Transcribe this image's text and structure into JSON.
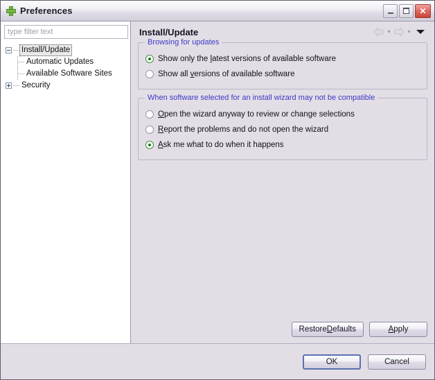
{
  "window": {
    "title": "Preferences",
    "icon": "green-plus-icon",
    "controls": {
      "minimize": "Minimize",
      "maximize": "Maximize",
      "close": "Close",
      "close_glyph": "✕"
    }
  },
  "sidebar": {
    "filter": {
      "value": "",
      "placeholder": "type filter text"
    },
    "tree": [
      {
        "label": "Install/Update",
        "expander": "minus",
        "level": 0,
        "selected": true
      },
      {
        "label": "Automatic Updates",
        "expander": "none",
        "level": 1,
        "selected": false
      },
      {
        "label": "Available Software Sites",
        "expander": "none",
        "level": 1,
        "selected": false
      },
      {
        "label": "Security",
        "expander": "plus",
        "level": 0,
        "selected": false
      }
    ]
  },
  "page": {
    "title": "Install/Update",
    "nav": {
      "back": "back-arrow",
      "forward": "forward-arrow",
      "menu": "dropdown-triangle"
    },
    "groups": [
      {
        "title": "Browsing for updates",
        "options": [
          {
            "pre": "Show only the ",
            "mnemonic": "l",
            "post": "atest versions of available software",
            "selected": true
          },
          {
            "pre": "Show all ",
            "mnemonic": "v",
            "post": "ersions of available software",
            "selected": false
          }
        ]
      },
      {
        "title": "When software selected for an install wizard may not be compatible",
        "options": [
          {
            "pre": "",
            "mnemonic": "O",
            "post": "pen the wizard anyway to review or change selections",
            "selected": false
          },
          {
            "pre": "",
            "mnemonic": "R",
            "post": "eport the problems and do not open the wizard",
            "selected": false
          },
          {
            "pre": "",
            "mnemonic": "A",
            "post": "sk me what to do when it happens",
            "selected": true
          }
        ]
      }
    ],
    "actions": {
      "restore_pre": "Restore ",
      "restore_mn": "D",
      "restore_post": "efaults",
      "apply_pre": "",
      "apply_mn": "A",
      "apply_post": "pply"
    }
  },
  "footer": {
    "ok": "OK",
    "cancel": "Cancel"
  },
  "colors": {
    "group_title": "#3a39c4",
    "content_bg": "#e3dee6",
    "tree_bg": "#ffffff",
    "radio_on": "#1c7a1c",
    "default_button_border": "#5c6fb0"
  }
}
